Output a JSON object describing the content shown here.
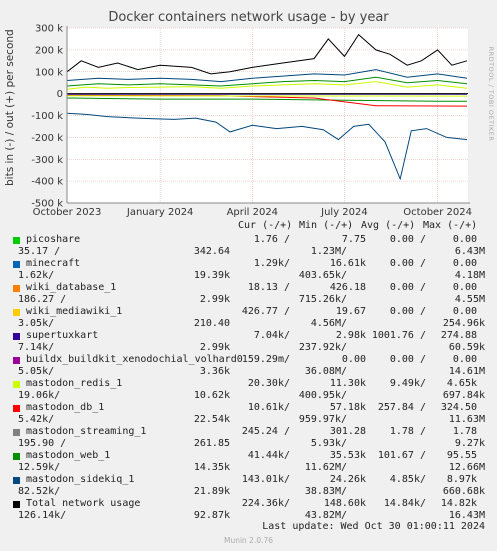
{
  "title": "Docker containers network usage - by year",
  "ylabel": "bits in (-) / out (+) per second",
  "side_label": "RRDTOOL / TOBI OETIKER",
  "header": {
    "cur": "Cur (-/+)",
    "min": "Min (-/+)",
    "avg": "Avg (-/+)",
    "max": "Max (-/+)"
  },
  "legend": [
    {
      "name": "picoshare",
      "color": "#00cc00",
      "cur": "1.76 /",
      "min": "7.75",
      "avg": "0.00 /",
      "max": "0.00",
      "l2a": "35.17 /",
      "l2b": "342.64",
      "l2c": "1.23M/",
      "l2d": "6.43M"
    },
    {
      "name": "minecraft",
      "color": "#0066b3",
      "cur": "1.29k/",
      "min": "16.61k",
      "avg": "0.00 /",
      "max": "0.00",
      "l2a": "1.62k/",
      "l2b": "19.39k",
      "l2c": "403.65k/",
      "l2d": "4.18M"
    },
    {
      "name": "wiki_database_1",
      "color": "#ff8000",
      "cur": "18.13 /",
      "min": "426.18",
      "avg": "0.00 /",
      "max": "0.00",
      "l2a": "186.27 /",
      "l2b": "2.99k",
      "l2c": "715.26k/",
      "l2d": "4.55M"
    },
    {
      "name": "wiki_mediawiki_1",
      "color": "#ffcc00",
      "cur": "426.77 /",
      "min": "19.67",
      "avg": "0.00 /",
      "max": "0.00",
      "l2a": "3.05k/",
      "l2b": "210.40",
      "l2c": "4.56M/",
      "l2d": "254.96k"
    },
    {
      "name": "supertuxkart",
      "color": "#330099",
      "cur": "7.04k/",
      "min": "2.98k",
      "avg": "1001.76 /",
      "max": "274.88",
      "l2a": "7.14k/",
      "l2b": "2.99k",
      "l2c": "237.92k/",
      "l2d": "60.59k"
    },
    {
      "name": "buildx_buildkit_xenodochial_volhard0",
      "color": "#990099",
      "cur": "159.29m/",
      "min": "0.00",
      "avg": "0.00 /",
      "max": "0.00",
      "l2a": "5.05k/",
      "l2b": "3.36k",
      "l2c": "36.08M/",
      "l2d": "14.61M"
    },
    {
      "name": "mastodon_redis_1",
      "color": "#ccff00",
      "cur": "20.30k/",
      "min": "11.30k",
      "avg": "9.49k/",
      "max": "4.65k",
      "l2a": "19.06k/",
      "l2b": "10.62k",
      "l2c": "400.95k/",
      "l2d": "697.84k"
    },
    {
      "name": "mastodon_db_1",
      "color": "#ff0000",
      "cur": "10.61k/",
      "min": "57.18k",
      "avg": "257.84 /",
      "max": "324.50",
      "l2a": "5.42k/",
      "l2b": "22.54k",
      "l2c": "959.97k/",
      "l2d": "11.63M"
    },
    {
      "name": "mastodon_streaming_1",
      "color": "#808080",
      "cur": "245.24 /",
      "min": "301.28",
      "avg": "1.78 /",
      "max": "1.78",
      "l2a": "195.90 /",
      "l2b": "261.85",
      "l2c": "5.93k/",
      "l2d": "9.27k"
    },
    {
      "name": "mastodon_web_1",
      "color": "#008f00",
      "cur": "41.44k/",
      "min": "35.53k",
      "avg": "101.67 /",
      "max": "95.55",
      "l2a": "12.59k/",
      "l2b": "14.35k",
      "l2c": "11.62M/",
      "l2d": "12.66M"
    },
    {
      "name": "mastodon_sidekiq_1",
      "color": "#00487d",
      "cur": "143.01k/",
      "min": "24.26k",
      "avg": "4.85k/",
      "max": "8.97k",
      "l2a": "82.52k/",
      "l2b": "21.89k",
      "l2c": "38.83M/",
      "l2d": "660.68k"
    },
    {
      "name": "Total network usage",
      "color": "#000000",
      "cur": "224.36k/",
      "min": "148.60k",
      "avg": "14.84k/",
      "max": "14.82k",
      "l2a": "126.14k/",
      "l2b": "92.87k",
      "l2c": "43.82M/",
      "l2d": "16.43M"
    }
  ],
  "last_update": "Last update: Wed Oct 30 01:00:11 2024",
  "footer": "Munin 2.0.76",
  "chart_data": {
    "type": "line",
    "title": "Docker containers network usage - by year",
    "ylabel": "bits in (-) / out (+) per second",
    "ylim": [
      -500000,
      300000
    ],
    "yticks": [
      {
        "v": 300000,
        "label": "300 k"
      },
      {
        "v": 200000,
        "label": "200 k"
      },
      {
        "v": 100000,
        "label": "100 k"
      },
      {
        "v": 0,
        "label": "0"
      },
      {
        "v": -100000,
        "label": "-100 k"
      },
      {
        "v": -200000,
        "label": "-200 k"
      },
      {
        "v": -300000,
        "label": "-300 k"
      },
      {
        "v": -400000,
        "label": "-400 k"
      },
      {
        "v": -500000,
        "label": "-500 k"
      }
    ],
    "xlim": [
      "2023-10-01",
      "2024-10-31"
    ],
    "xticks": [
      {
        "date": "2023-10-01",
        "label": "October 2023"
      },
      {
        "date": "2024-01-01",
        "label": "January 2024"
      },
      {
        "date": "2024-04-01",
        "label": "April 2024"
      },
      {
        "date": "2024-07-01",
        "label": "July 2024"
      },
      {
        "date": "2024-10-01",
        "label": "October 2024"
      }
    ],
    "series": [
      {
        "name": "mastodon_sidekiq_1",
        "color": "#00487d",
        "points": [
          [
            "2023-10-01",
            -90000
          ],
          [
            "2023-10-20",
            -95000
          ],
          [
            "2023-11-10",
            -105000
          ],
          [
            "2023-12-01",
            -110000
          ],
          [
            "2023-12-25",
            -115000
          ],
          [
            "2024-01-15",
            -118000
          ],
          [
            "2024-02-05",
            -112000
          ],
          [
            "2024-02-25",
            -130000
          ],
          [
            "2024-03-10",
            -175000
          ],
          [
            "2024-04-01",
            -145000
          ],
          [
            "2024-04-25",
            -160000
          ],
          [
            "2024-05-20",
            -150000
          ],
          [
            "2024-06-10",
            -165000
          ],
          [
            "2024-06-25",
            -210000
          ],
          [
            "2024-07-10",
            -150000
          ],
          [
            "2024-07-25",
            -140000
          ],
          [
            "2024-08-10",
            -220000
          ],
          [
            "2024-08-25",
            -390000
          ],
          [
            "2024-09-05",
            -170000
          ],
          [
            "2024-09-20",
            -160000
          ],
          [
            "2024-10-10",
            -200000
          ],
          [
            "2024-10-30",
            -210000
          ]
        ]
      },
      {
        "name": "mastodon_web_1",
        "color": "#008f00",
        "points": [
          [
            "2023-10-01",
            -20000
          ],
          [
            "2024-01-01",
            -25000
          ],
          [
            "2024-04-01",
            -25000
          ],
          [
            "2024-07-01",
            -30000
          ],
          [
            "2024-10-01",
            -35000
          ],
          [
            "2024-10-30",
            -35000
          ]
        ]
      },
      {
        "name": "mastodon_db_1",
        "color": "#ff0000",
        "points": [
          [
            "2023-10-01",
            -8000
          ],
          [
            "2024-03-01",
            -10000
          ],
          [
            "2024-06-01",
            -20000
          ],
          [
            "2024-08-01",
            -55000
          ],
          [
            "2024-10-30",
            -57000
          ]
        ]
      },
      {
        "name": "mastodon_redis_1",
        "color": "#ccff00",
        "points": [
          [
            "2023-10-01",
            -10000
          ],
          [
            "2024-04-01",
            -11000
          ],
          [
            "2024-10-30",
            -11300
          ]
        ]
      },
      {
        "name": "supertuxkart",
        "color": "#330099",
        "points": [
          [
            "2023-10-01",
            -3000
          ],
          [
            "2024-10-30",
            -3000
          ]
        ]
      },
      {
        "name": "mastodon_redis_1",
        "color": "#ccff00",
        "points": [
          [
            "2023-10-01",
            20000
          ],
          [
            "2023-10-20",
            30000
          ],
          [
            "2023-11-10",
            25000
          ],
          [
            "2023-12-01",
            28000
          ],
          [
            "2024-01-01",
            30000
          ],
          [
            "2024-02-01",
            32000
          ],
          [
            "2024-03-01",
            25000
          ],
          [
            "2024-04-01",
            35000
          ],
          [
            "2024-05-01",
            40000
          ],
          [
            "2024-06-01",
            45000
          ],
          [
            "2024-07-01",
            40000
          ],
          [
            "2024-08-01",
            55000
          ],
          [
            "2024-09-01",
            30000
          ],
          [
            "2024-10-01",
            40000
          ],
          [
            "2024-10-30",
            25000
          ]
        ]
      },
      {
        "name": "mastodon_web_1",
        "color": "#008f00",
        "points": [
          [
            "2023-10-01",
            35000
          ],
          [
            "2023-11-01",
            45000
          ],
          [
            "2023-12-01",
            40000
          ],
          [
            "2024-01-01",
            45000
          ],
          [
            "2024-02-01",
            40000
          ],
          [
            "2024-03-01",
            35000
          ],
          [
            "2024-04-01",
            45000
          ],
          [
            "2024-05-01",
            55000
          ],
          [
            "2024-06-01",
            60000
          ],
          [
            "2024-07-01",
            55000
          ],
          [
            "2024-08-01",
            75000
          ],
          [
            "2024-09-01",
            50000
          ],
          [
            "2024-10-01",
            60000
          ],
          [
            "2024-10-30",
            45000
          ]
        ]
      },
      {
        "name": "mastodon_sidekiq_1",
        "color": "#00487d",
        "points": [
          [
            "2023-10-01",
            60000
          ],
          [
            "2023-11-01",
            70000
          ],
          [
            "2023-12-01",
            65000
          ],
          [
            "2024-01-01",
            70000
          ],
          [
            "2024-02-01",
            65000
          ],
          [
            "2024-03-01",
            55000
          ],
          [
            "2024-04-01",
            70000
          ],
          [
            "2024-05-01",
            80000
          ],
          [
            "2024-06-01",
            90000
          ],
          [
            "2024-07-01",
            85000
          ],
          [
            "2024-08-01",
            110000
          ],
          [
            "2024-09-01",
            75000
          ],
          [
            "2024-10-01",
            90000
          ],
          [
            "2024-10-30",
            70000
          ]
        ]
      },
      {
        "name": "Total network usage",
        "color": "#000000",
        "points": [
          [
            "2023-10-01",
            100000
          ],
          [
            "2023-10-15",
            150000
          ],
          [
            "2023-11-01",
            120000
          ],
          [
            "2023-11-20",
            140000
          ],
          [
            "2023-12-10",
            110000
          ],
          [
            "2024-01-01",
            130000
          ],
          [
            "2024-02-01",
            120000
          ],
          [
            "2024-02-20",
            90000
          ],
          [
            "2024-03-10",
            100000
          ],
          [
            "2024-04-01",
            120000
          ],
          [
            "2024-05-01",
            140000
          ],
          [
            "2024-06-01",
            160000
          ],
          [
            "2024-06-15",
            250000
          ],
          [
            "2024-07-01",
            170000
          ],
          [
            "2024-07-15",
            270000
          ],
          [
            "2024-08-01",
            200000
          ],
          [
            "2024-08-15",
            180000
          ],
          [
            "2024-09-01",
            130000
          ],
          [
            "2024-09-15",
            150000
          ],
          [
            "2024-10-01",
            200000
          ],
          [
            "2024-10-15",
            130000
          ],
          [
            "2024-10-30",
            150000
          ]
        ]
      }
    ]
  }
}
